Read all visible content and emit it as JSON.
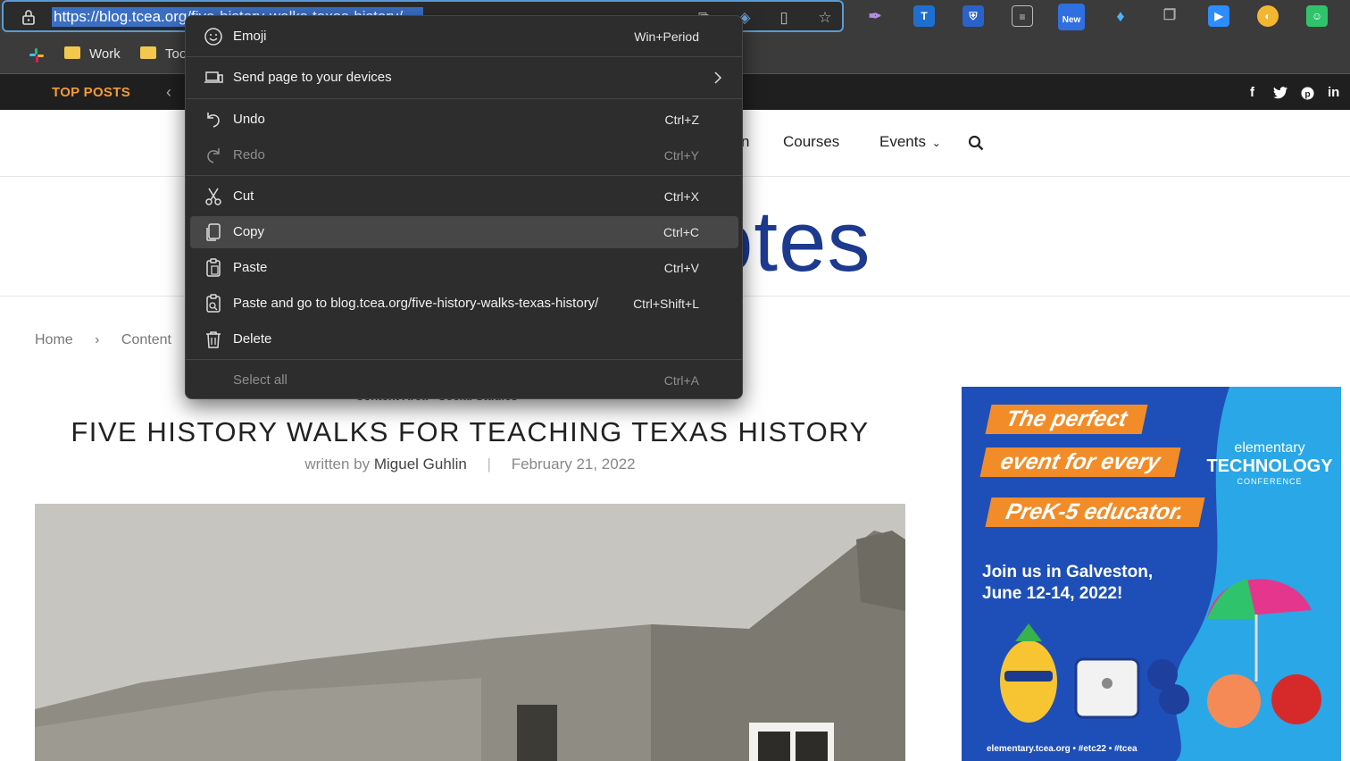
{
  "browser": {
    "url": "https://blog.tcea.org/five-history-walks-texas-history/",
    "bookmarks": [
      "Work",
      "Too"
    ],
    "extension_badge": "New",
    "extension_letter": "T"
  },
  "site": {
    "top_posts_label": "TOP POSTS",
    "nav": {
      "partial_item": "n",
      "courses": "Courses",
      "events": "Events"
    },
    "logo_partial": "otes",
    "breadcrumb": [
      "Home",
      "›",
      "Content"
    ],
    "categories": "Content Area    ·    Social Studies",
    "article_title": "FIVE HISTORY WALKS FOR TEACHING TEXAS HISTORY",
    "byline_prefix": "written by",
    "author": "Miguel Guhlin",
    "date": "February 21, 2022"
  },
  "ad": {
    "line1": "The perfect",
    "line2": "event for every",
    "line3": "PreK-5 educator.",
    "brand_small": "elementary",
    "brand_big": "TECHNOLOGY",
    "brand_sub": "CONFERENCE",
    "join": "Join us in Galveston,",
    "dates": "June 12-14, 2022!",
    "footer": "elementary.tcea.org • #etc22 • #tcea"
  },
  "context_menu": {
    "items": [
      {
        "label": "Emoji",
        "shortcut": "Win+Period",
        "icon": "emoji-icon"
      },
      {
        "label": "Send page to your devices",
        "shortcut": "",
        "icon": "devices-icon"
      },
      {
        "label": "Undo",
        "shortcut": "Ctrl+Z",
        "icon": "undo-icon"
      },
      {
        "label": "Redo",
        "shortcut": "Ctrl+Y",
        "icon": "redo-icon"
      },
      {
        "label": "Cut",
        "shortcut": "Ctrl+X",
        "icon": "cut-icon"
      },
      {
        "label": "Copy",
        "shortcut": "Ctrl+C",
        "icon": "copy-icon"
      },
      {
        "label": "Paste",
        "shortcut": "Ctrl+V",
        "icon": "paste-icon"
      },
      {
        "label": "Paste and go to blog.tcea.org/five-history-walks-texas-history/",
        "shortcut": "Ctrl+Shift+L",
        "icon": "paste-go-icon"
      },
      {
        "label": "Delete",
        "shortcut": "",
        "icon": "delete-icon"
      },
      {
        "label": "Select all",
        "shortcut": "Ctrl+A",
        "icon": ""
      }
    ]
  },
  "colors": {
    "accent_selection": "#3b6fc4",
    "top_posts": "#f39c34",
    "logo_blue": "#1d3a8f",
    "ad_bg": "#2aa7e6",
    "ad_orange": "#f28c28"
  }
}
